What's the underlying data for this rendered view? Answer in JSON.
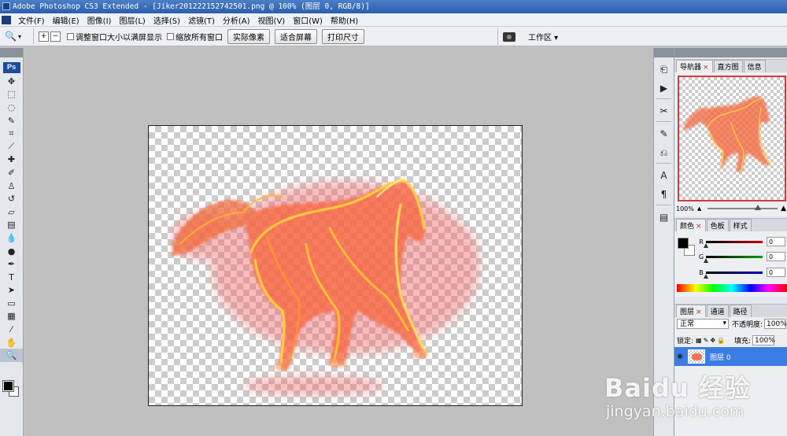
{
  "window": {
    "title": "Adobe Photoshop CS3 Extended - [Jiker201222152742501.png @ 100% (图层 0, RGB/8)]"
  },
  "menu": [
    "文件(F)",
    "编辑(E)",
    "图像(I)",
    "图层(L)",
    "选择(S)",
    "滤镜(T)",
    "分析(A)",
    "视图(V)",
    "窗口(W)",
    "帮助(H)"
  ],
  "options": {
    "resize_windows_label": "调整窗口大小以满屏显示",
    "zoom_all_label": "缩放所有窗口",
    "actual_pixels": "实际像素",
    "fit_screen": "适合屏幕",
    "print_size": "打印尺寸",
    "workspace": "工作区 ▾"
  },
  "toolbox": {
    "logo": "Ps",
    "tools": [
      {
        "name": "move-tool",
        "glyph": "✥"
      },
      {
        "name": "marquee-tool",
        "glyph": "⬚"
      },
      {
        "name": "lasso-tool",
        "glyph": "◌"
      },
      {
        "name": "quick-select-tool",
        "glyph": "✎"
      },
      {
        "name": "crop-tool",
        "glyph": "⌗"
      },
      {
        "name": "slice-tool",
        "glyph": "⟋"
      },
      {
        "name": "healing-brush-tool",
        "glyph": "✚"
      },
      {
        "name": "brush-tool",
        "glyph": "✐"
      },
      {
        "name": "clone-stamp-tool",
        "glyph": "♙"
      },
      {
        "name": "history-brush-tool",
        "glyph": "↺"
      },
      {
        "name": "eraser-tool",
        "glyph": "▱"
      },
      {
        "name": "gradient-tool",
        "glyph": "▤"
      },
      {
        "name": "blur-tool",
        "glyph": "💧"
      },
      {
        "name": "dodge-tool",
        "glyph": "●"
      },
      {
        "name": "pen-tool",
        "glyph": "✒"
      },
      {
        "name": "type-tool",
        "glyph": "T"
      },
      {
        "name": "path-select-tool",
        "glyph": "➤"
      },
      {
        "name": "shape-tool",
        "glyph": "▭"
      },
      {
        "name": "notes-tool",
        "glyph": "▦"
      },
      {
        "name": "eyedropper-tool",
        "glyph": "⁄"
      },
      {
        "name": "hand-tool",
        "glyph": "✋"
      },
      {
        "name": "zoom-tool",
        "glyph": "🔍"
      }
    ]
  },
  "navigator": {
    "tabs": [
      "导航器",
      "直方图",
      "信息"
    ],
    "zoom": "100%"
  },
  "color": {
    "tabs": [
      "颜色",
      "色板",
      "样式"
    ],
    "channels": [
      {
        "label": "R",
        "value": "0",
        "gradient": "#c40000"
      },
      {
        "label": "G",
        "value": "0",
        "gradient": "#00a000"
      },
      {
        "label": "B",
        "value": "0",
        "gradient": "#0000c0"
      }
    ]
  },
  "layers": {
    "tabs": [
      "图层",
      "通道",
      "路径"
    ],
    "blend_mode": "正常",
    "opacity_label": "不透明度:",
    "opacity": "100%",
    "lock_label": "锁定:",
    "fill_label": "填充:",
    "fill": "100%",
    "layer_name": "图层 0"
  },
  "watermark": {
    "main": "Baidu 经验",
    "url": "jingyan.baidu.com"
  }
}
